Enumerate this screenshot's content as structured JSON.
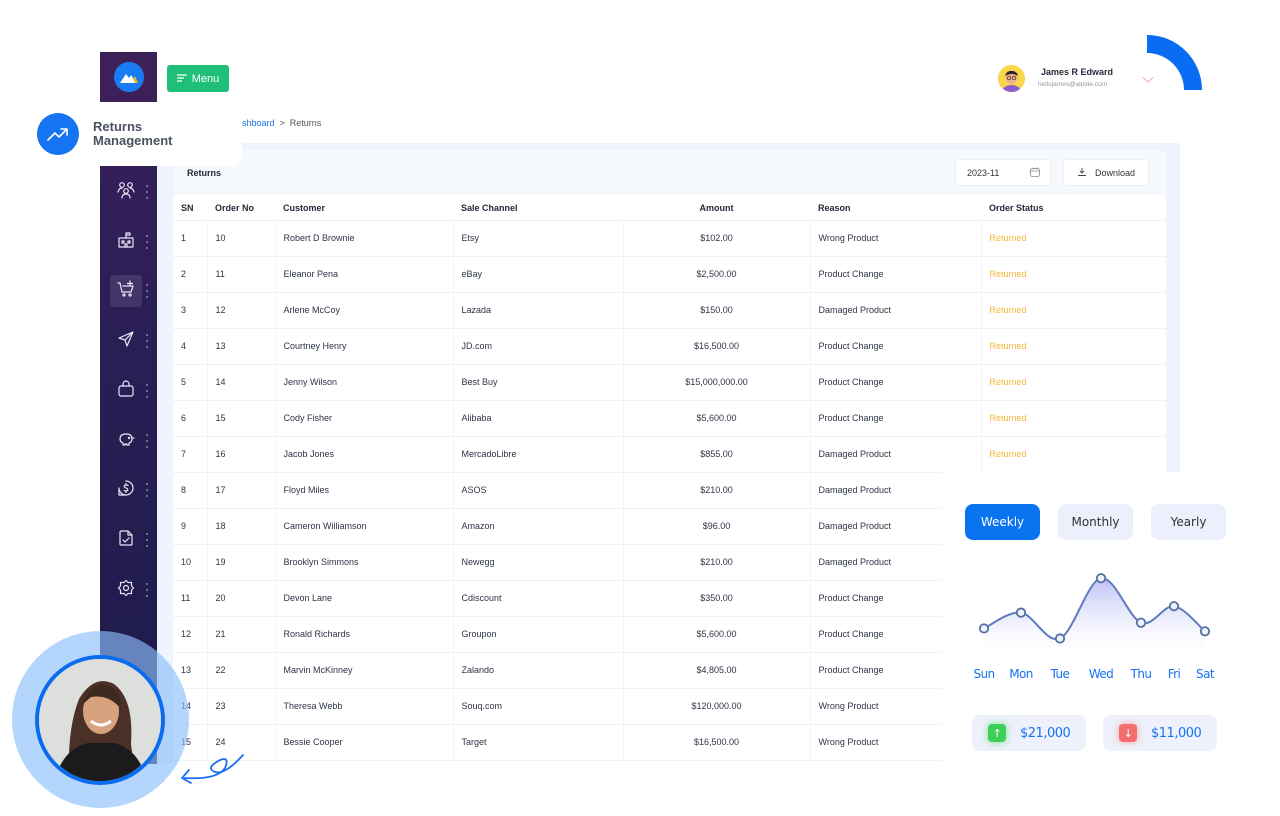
{
  "app": {
    "menu_label": "Menu",
    "section_title_line1": "Returns",
    "section_title_line2": "Management"
  },
  "breadcrumb": {
    "parent": "shboard",
    "separator": ">",
    "current": "Returns"
  },
  "user": {
    "name": "James R Edward",
    "email": "hellojames@alpide.com"
  },
  "sidebar": {
    "items": [
      {
        "icon": "users-icon"
      },
      {
        "icon": "school-icon"
      },
      {
        "icon": "cart-plus-icon",
        "active": true
      },
      {
        "icon": "send-icon"
      },
      {
        "icon": "shopping-bag-icon"
      },
      {
        "icon": "piggy-bank-icon"
      },
      {
        "icon": "dollar-icon"
      },
      {
        "icon": "document-check-icon"
      },
      {
        "icon": "settings-icon"
      }
    ]
  },
  "card": {
    "title": "Returns",
    "date_value": "2023-11",
    "download_label": "Download"
  },
  "table": {
    "headers": [
      "SN",
      "Order No",
      "Customer",
      "Sale Channel",
      "Amount",
      "Reason",
      "Order Status"
    ],
    "rows": [
      [
        "1",
        "10",
        "Robert D Brownie",
        "Etsy",
        "$102.00",
        "Wrong Product",
        "Returned"
      ],
      [
        "2",
        "11",
        "Eleanor Pena",
        "eBay",
        "$2,500.00",
        "Product Change",
        "Returned"
      ],
      [
        "3",
        "12",
        "Arlene McCoy",
        "Lazada",
        "$150.00",
        "Damaged Product",
        "Returned"
      ],
      [
        "4",
        "13",
        "Courtney Henry",
        "JD.com",
        "$16,500.00",
        "Product Change",
        "Returned"
      ],
      [
        "5",
        "14",
        "Jenny Wilson",
        "Best Buy",
        "$15,000,000.00",
        "Product Change",
        "Returned"
      ],
      [
        "6",
        "15",
        "Cody Fisher",
        "Alibaba",
        "$5,600.00",
        "Product Change",
        "Returned"
      ],
      [
        "7",
        "16",
        "Jacob Jones",
        "MercadoLibre",
        "$855.00",
        "Damaged Product",
        "Returned"
      ],
      [
        "8",
        "17",
        "Floyd Miles",
        "ASOS",
        "$210.00",
        "Damaged Product",
        ""
      ],
      [
        "9",
        "18",
        "Cameron Williamson",
        "Amazon",
        "$96.00",
        "Damaged Product",
        ""
      ],
      [
        "10",
        "19",
        "Brooklyn Simmons",
        "Newegg",
        "$210.00",
        "Damaged Product",
        ""
      ],
      [
        "11",
        "20",
        "Devon Lane",
        "Cdiscount",
        "$350.00",
        "Product Change",
        ""
      ],
      [
        "12",
        "21",
        "Ronald Richards",
        "Groupon",
        "$5,600.00",
        "Product Change",
        ""
      ],
      [
        "13",
        "22",
        "Marvin McKinney",
        "Zalando",
        "$4,805.00",
        "Product Change",
        ""
      ],
      [
        "14",
        "23",
        "Theresa Webb",
        "Souq.com",
        "$120,000.00",
        "Wrong Product",
        ""
      ],
      [
        "15",
        "24",
        "Bessie Cooper",
        "Target",
        "$16,500.00",
        "Wrong Product",
        ""
      ]
    ]
  },
  "widget": {
    "periods": [
      "Weekly",
      "Monthly",
      "Yearly"
    ],
    "active_period": "Weekly",
    "stats": [
      {
        "direction": "up",
        "value": "$21,000",
        "color": "#3ccf5a"
      },
      {
        "direction": "down",
        "value": "$11,000",
        "color": "#f46e6e"
      }
    ]
  },
  "chart_data": {
    "type": "line",
    "title": "",
    "categories": [
      "Sun",
      "Mon",
      "Tue",
      "Wed",
      "Thu",
      "Fri",
      "Sat"
    ],
    "values": [
      30,
      52,
      16,
      100,
      38,
      61,
      26
    ],
    "ylim": [
      0,
      110
    ],
    "xlabel": "",
    "ylabel": "",
    "grid": false,
    "smooth": true,
    "area_fill": true
  },
  "colors": {
    "accent": "#1673f2",
    "menu_green": "#1fbf7a",
    "status_returned": "#f5b63b",
    "sidebar": "#2a1f55"
  }
}
